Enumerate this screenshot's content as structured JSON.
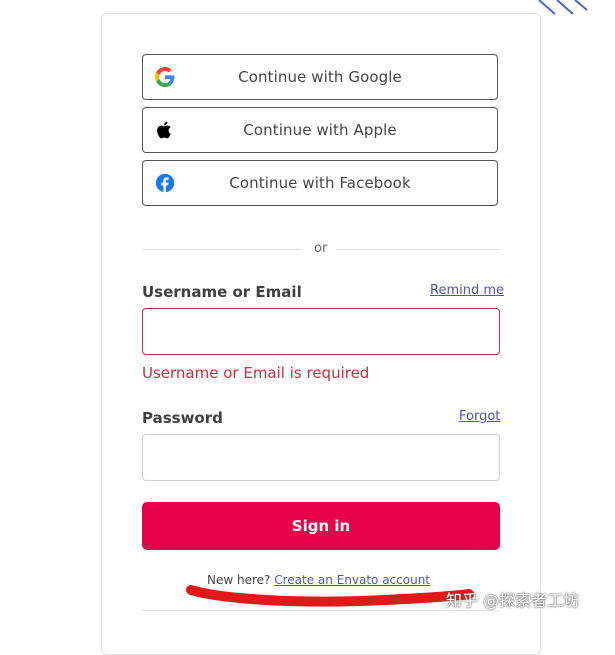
{
  "sso": {
    "google": {
      "label": "Continue with Google",
      "icon": "google-icon"
    },
    "apple": {
      "label": "Continue with Apple",
      "icon": "apple-icon"
    },
    "facebook": {
      "label": "Continue with Facebook",
      "icon": "facebook-icon"
    }
  },
  "divider": {
    "text": "or"
  },
  "username": {
    "label": "Username or Email",
    "value": "",
    "link": "Remind me",
    "error": "Username or Email is required"
  },
  "password": {
    "label": "Password",
    "value": "",
    "link": "Forgot"
  },
  "signin": {
    "label": "Sign in"
  },
  "footer": {
    "prompt": "New here?",
    "link": "Create an Envato account"
  },
  "watermark": "知乎 @探索者工坊",
  "colors": {
    "primary": "#e4004a",
    "link": "#4a57b0",
    "error": "#c0303f",
    "facebook": "#1877f2"
  }
}
